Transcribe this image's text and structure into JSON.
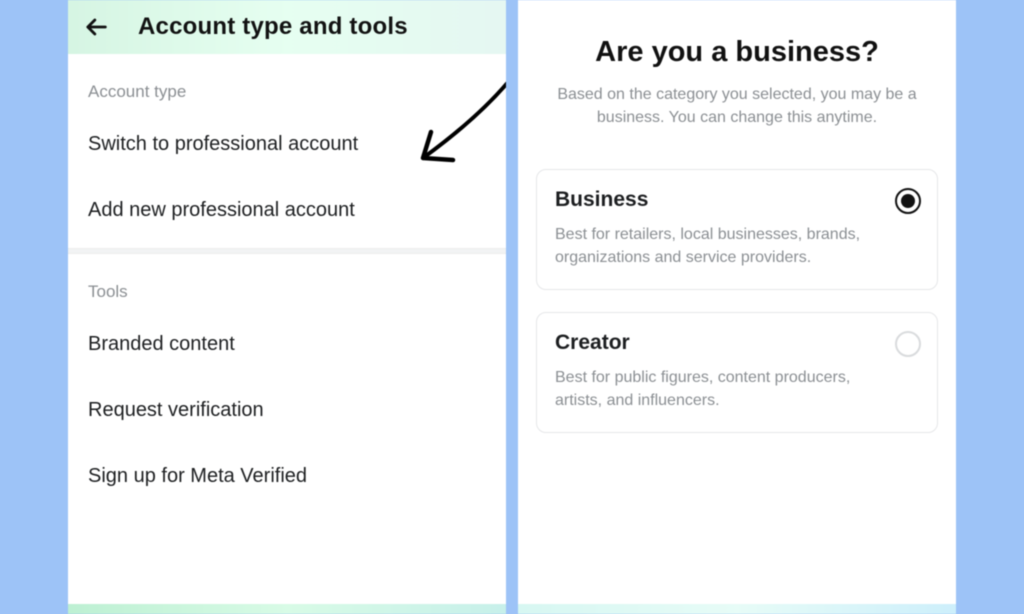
{
  "left": {
    "title": "Account type and tools",
    "sections": {
      "accountType": {
        "label": "Account type",
        "items": [
          "Switch to professional account",
          "Add new professional account"
        ]
      },
      "tools": {
        "label": "Tools",
        "items": [
          "Branded content",
          "Request verification",
          "Sign up for Meta Verified"
        ]
      }
    }
  },
  "right": {
    "heading": "Are you a business?",
    "sub": "Based on the category you selected, you may be a business. You can change this anytime.",
    "options": {
      "business": {
        "title": "Business",
        "desc": "Best for retailers, local businesses, brands, organizations and service providers.",
        "selected": true
      },
      "creator": {
        "title": "Creator",
        "desc": "Best for public figures, content producers, artists, and influencers.",
        "selected": false
      }
    }
  }
}
